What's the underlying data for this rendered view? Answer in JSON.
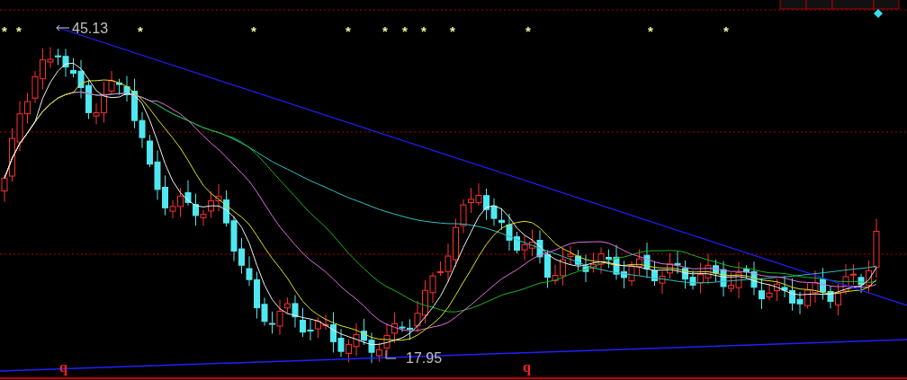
{
  "price_chart": {
    "high_label": "45.13",
    "low_label": "17.95",
    "markers": [
      "q",
      "q"
    ],
    "stars": [
      "*",
      "*",
      "*",
      "*",
      "*",
      "*",
      "*",
      "*",
      "*",
      "*",
      "*",
      "*"
    ]
  }
}
